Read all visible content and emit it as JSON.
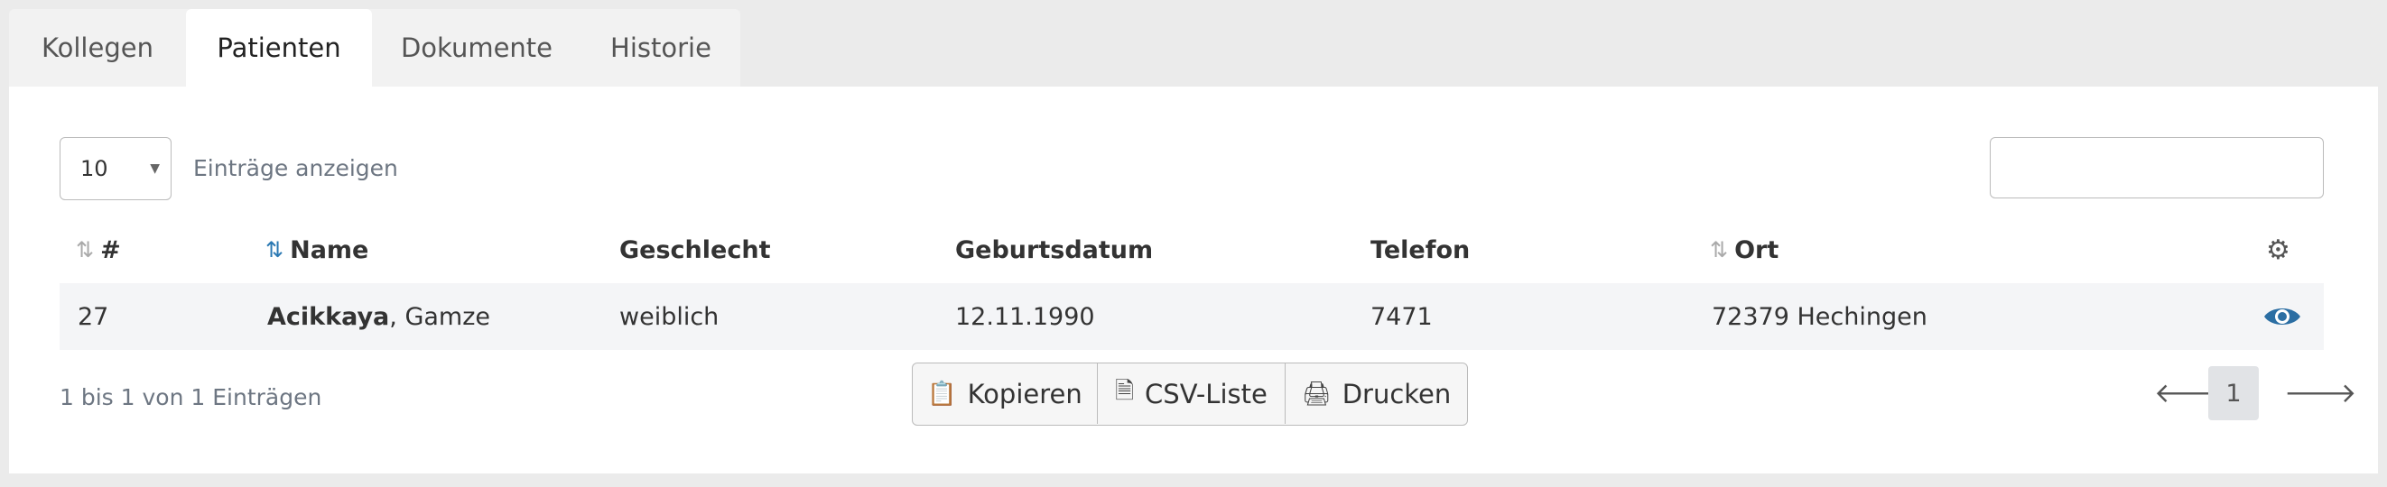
{
  "tabs": [
    {
      "label": "Kollegen"
    },
    {
      "label": "Patienten"
    },
    {
      "label": "Dokumente"
    },
    {
      "label": "Historie"
    }
  ],
  "active_tab": "Patienten",
  "table_controls": {
    "length_value": "10",
    "length_label": "Einträge anzeigen",
    "search_value": ""
  },
  "columns": [
    "#",
    "Name",
    "Geschlecht",
    "Geburtsdatum",
    "Telefon",
    "Ort"
  ],
  "sort_icons": {
    "unsorted": "⇅",
    "ascending": "⇅"
  },
  "rows": [
    {
      "id": "27",
      "last_name": "Acikkaya",
      "first_name": ", Gamze",
      "gender": "weiblich",
      "birthdate": "12.11.1990",
      "phone": "7471",
      "city": "72379 Hechingen"
    }
  ],
  "info_text": "1 bis 1 von 1 Einträgen",
  "buttons": {
    "copy": "Kopieren",
    "csv": "CSV-Liste",
    "print": "Drucken"
  },
  "pagination": {
    "prev": "🡐",
    "current_page": "1",
    "next": "🡒"
  },
  "icons": {
    "settings": "gear-icon",
    "view": "eye-icon",
    "clipboard": "clipboard-icon",
    "file": "file-csv-icon",
    "printer": "printer-icon"
  },
  "colors": {
    "accent": "#2b79b3",
    "row_bg": "#f4f5f7",
    "page_bg": "#ebebeb"
  }
}
